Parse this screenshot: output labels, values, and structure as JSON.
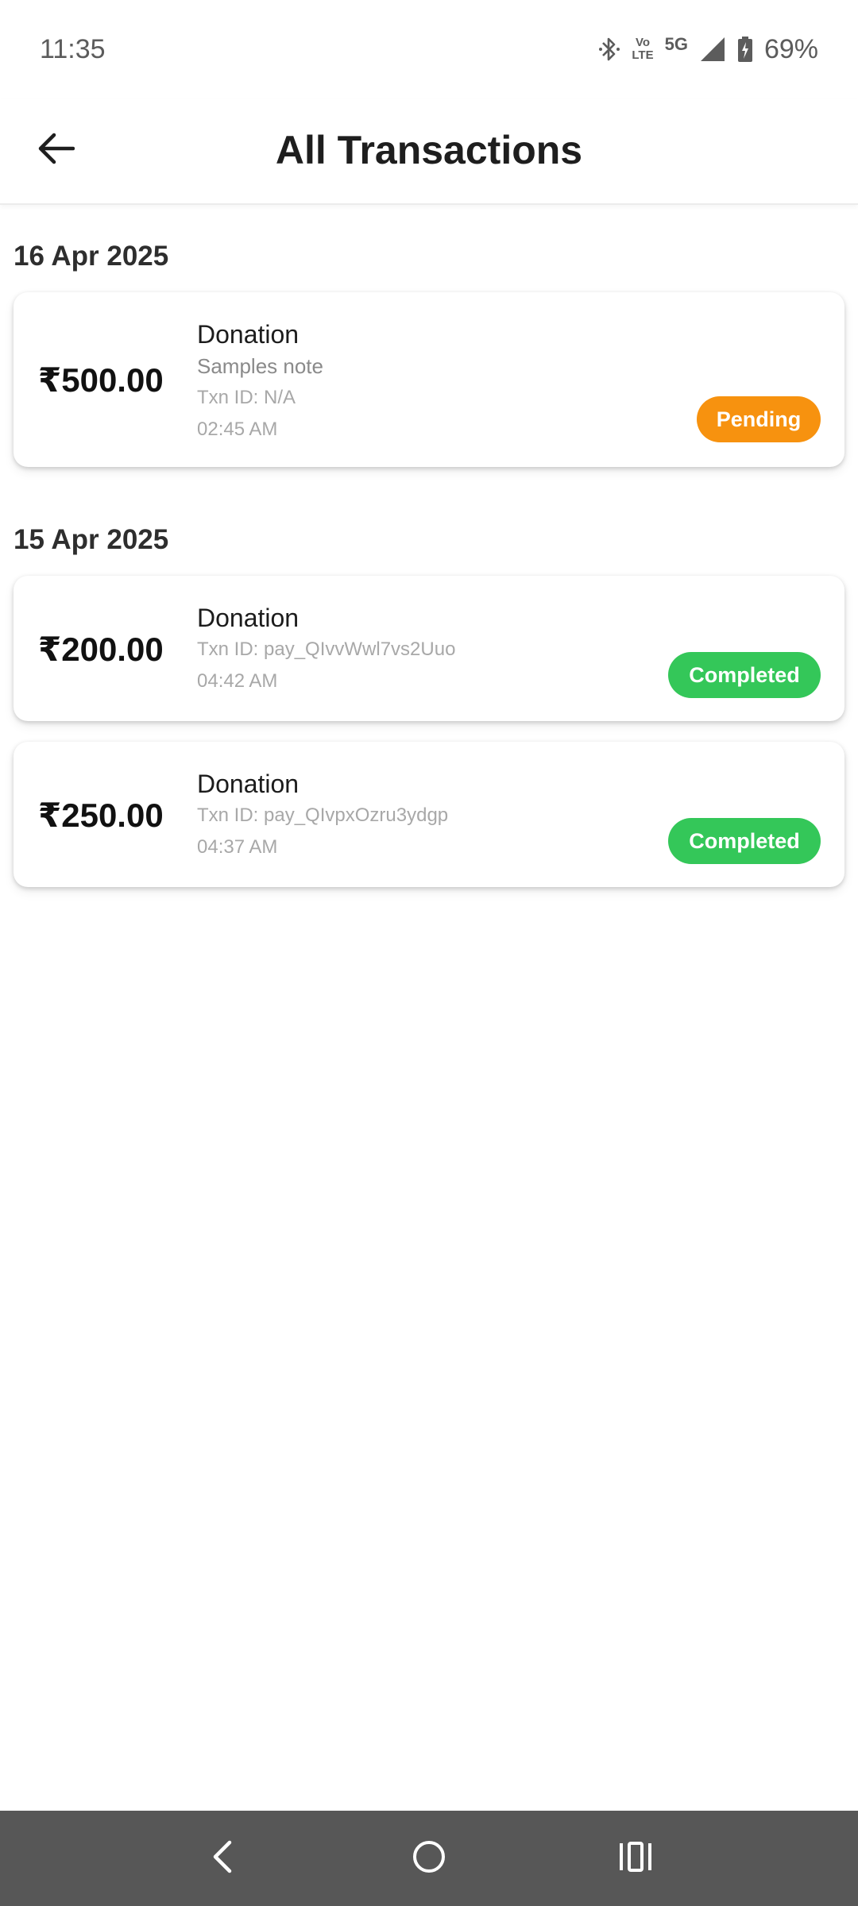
{
  "status_bar": {
    "time": "11:35",
    "lte_top": "Vo",
    "lte_bottom": "LTE",
    "network": "5G",
    "battery": "69%"
  },
  "app_bar": {
    "title": "All Transactions",
    "back_icon": "arrow-left-icon"
  },
  "groups": [
    {
      "date": "16 Apr 2025",
      "transactions": [
        {
          "amount": "₹500.00",
          "title": "Donation",
          "note": "Samples note",
          "txn_id": "Txn ID: N/A",
          "time": "02:45 AM",
          "status": "Pending",
          "status_color": "#F7920F"
        }
      ]
    },
    {
      "date": "15 Apr 2025",
      "transactions": [
        {
          "amount": "₹200.00",
          "title": "Donation",
          "txn_id": "Txn ID: pay_QIvvWwl7vs2Uuo",
          "time": "04:42 AM",
          "status": "Completed",
          "status_color": "#34C759"
        },
        {
          "amount": "₹250.00",
          "title": "Donation",
          "txn_id": "Txn ID: pay_QIvpxOzru3ydgp",
          "time": "04:37 AM",
          "status": "Completed",
          "status_color": "#34C759"
        }
      ]
    }
  ],
  "nav_bar": {
    "back_icon": "chevron-left-icon",
    "home_icon": "circle-home-icon",
    "recents_icon": "recents-icon"
  },
  "colors": {
    "pending": "#F7920F",
    "completed": "#34C759",
    "nav_bar": "#575757"
  }
}
